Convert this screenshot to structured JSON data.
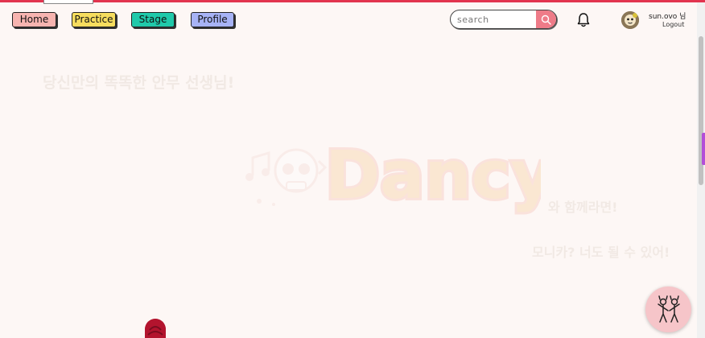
{
  "nav": {
    "home": "Home",
    "practice": "Practice",
    "stage": "Stage",
    "profile": "Profile"
  },
  "search": {
    "placeholder": "search",
    "icon": "search-icon"
  },
  "notifications": {
    "icon": "bell-icon"
  },
  "user": {
    "name": "sun.ovo 님",
    "logout": "Logout",
    "avatar_icon": "avatar"
  },
  "hero": {
    "tagline": "당신만의 똑똑한 안무 선생님!",
    "logo_text": "Dancy",
    "line1": "와 함께라면!",
    "line2": "모니카? 너도 될 수 있어!"
  },
  "colors": {
    "accent": "#e2344f",
    "home": "#f7b4b0",
    "practice": "#f6dd5e",
    "stage": "#20c9aa",
    "profile": "#a7b3f6",
    "search_button": "#ee7b88",
    "fab": "#f6c5c9"
  }
}
